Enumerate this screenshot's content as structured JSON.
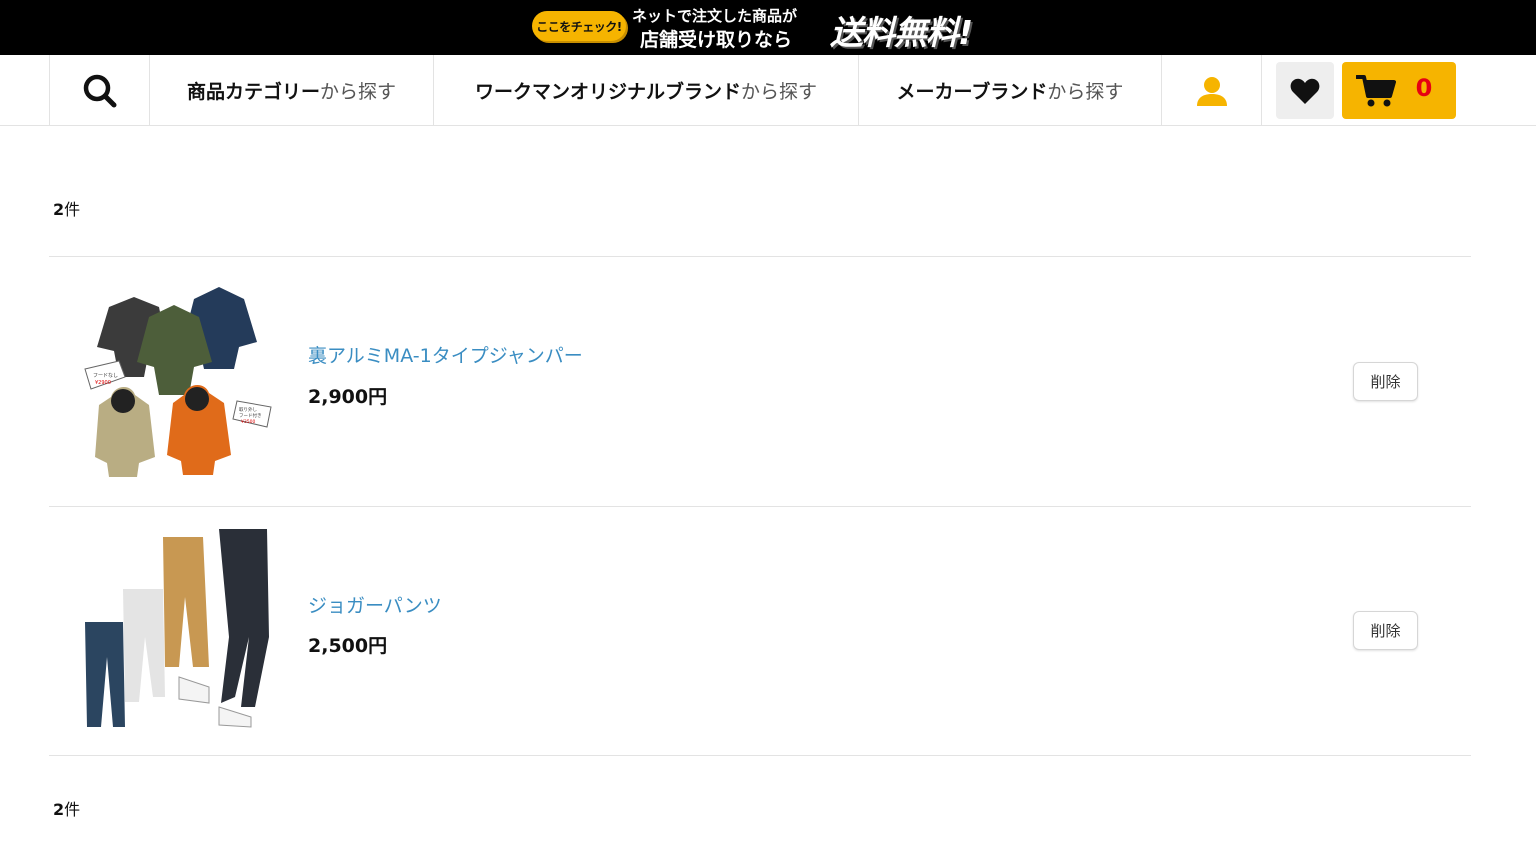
{
  "banner": {
    "check_label": "ここをチェック!",
    "line1": "ネットで注文した商品が",
    "line2": "店舗受け取りなら",
    "highlight": "送料無料!"
  },
  "nav": {
    "category": {
      "bold": "商品カテゴリー",
      "suffix": "から探す"
    },
    "original_brand": {
      "bold": "ワークマンオリジナルブランド",
      "suffix": "から探す"
    },
    "maker_brand": {
      "bold": "メーカーブランド",
      "suffix": "から探す"
    },
    "cart_count": "0"
  },
  "icons": {
    "search": "search-icon",
    "user": "user-icon",
    "favorite": "heart-icon",
    "cart": "cart-icon"
  },
  "colors": {
    "accent": "#f6b400",
    "link": "#3a8dc2",
    "cart_count": "#e60012"
  },
  "result_count": {
    "number": "2",
    "unit": "件"
  },
  "items": [
    {
      "name": "裏アルミMA-1タイプジャンパー",
      "price": "2,900円",
      "delete_label": "削除",
      "image_tags": [
        "フードなし ¥2900",
        "取り外し フード付き ¥3500"
      ]
    },
    {
      "name": "ジョガーパンツ",
      "price": "2,500円",
      "delete_label": "削除"
    }
  ]
}
